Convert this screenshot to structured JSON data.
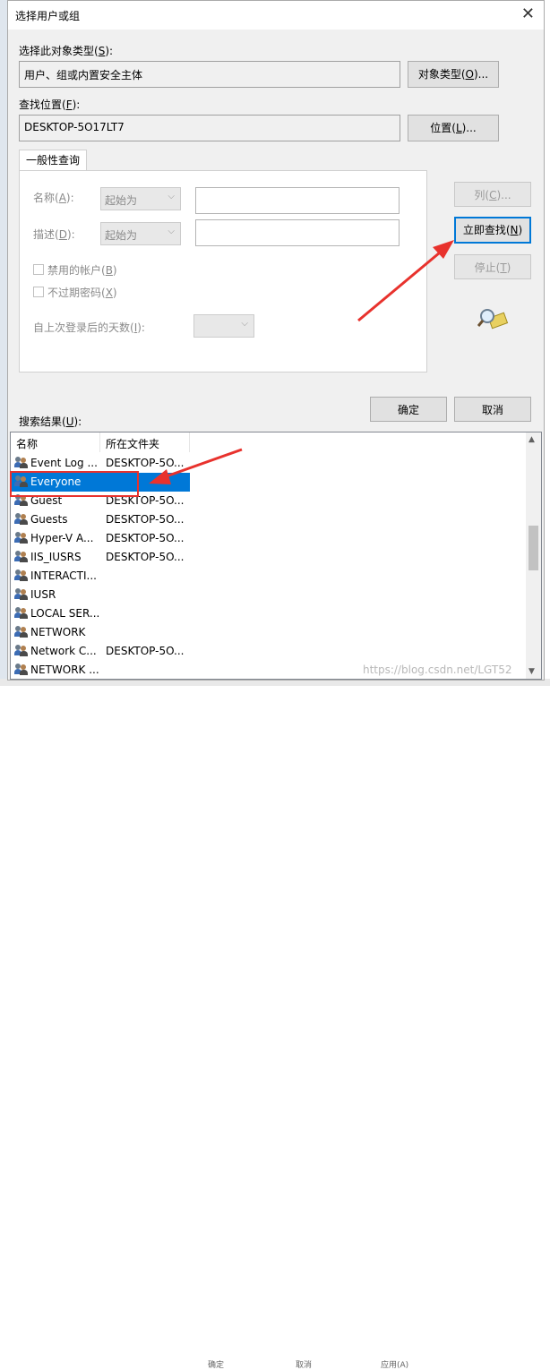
{
  "window": {
    "title": "选择用户或组"
  },
  "object_type": {
    "label_prefix": "选择此对象类型(",
    "label_key": "S",
    "label_suffix": "):",
    "value": "用户、组或内置安全主体",
    "button_prefix": "对象类型(",
    "button_key": "O",
    "button_suffix": ")..."
  },
  "location": {
    "label_prefix": "查找位置(",
    "label_key": "F",
    "label_suffix": "):",
    "value": "DESKTOP-5O17LT7",
    "button_prefix": "位置(",
    "button_key": "L",
    "button_suffix": ")..."
  },
  "general_query": {
    "tab_label": "一般性查询",
    "name_label_prefix": "名称(",
    "name_label_key": "A",
    "name_label_suffix": "):",
    "name_mode": "起始为",
    "desc_label_prefix": "描述(",
    "desc_label_key": "D",
    "desc_label_suffix": "):",
    "desc_mode": "起始为",
    "disabled_accounts_prefix": "禁用的帐户(",
    "disabled_accounts_key": "B",
    "disabled_accounts_suffix": ")",
    "non_expiring_prefix": "不过期密码(",
    "non_expiring_key": "X",
    "non_expiring_suffix": ")",
    "days_since_prefix": "自上次登录后的天数(",
    "days_since_key": "I",
    "days_since_suffix": "):"
  },
  "side_buttons": {
    "columns_prefix": "列(",
    "columns_key": "C",
    "columns_suffix": ")...",
    "find_now_prefix": "立即查找(",
    "find_now_key": "N",
    "find_now_suffix": ")",
    "stop_prefix": "停止(",
    "stop_key": "T",
    "stop_suffix": ")"
  },
  "ok_label": "确定",
  "cancel_label": "取消",
  "results": {
    "label_prefix": "搜索结果(",
    "label_key": "U",
    "label_suffix": "):",
    "columns": [
      "名称",
      "所在文件夹"
    ],
    "rows": [
      {
        "name": "Event Log ...",
        "folder": "DESKTOP-5O..."
      },
      {
        "name": "Everyone",
        "folder": ""
      },
      {
        "name": "Guest",
        "folder": "DESKTOP-5O..."
      },
      {
        "name": "Guests",
        "folder": "DESKTOP-5O..."
      },
      {
        "name": "Hyper-V A...",
        "folder": "DESKTOP-5O..."
      },
      {
        "name": "IIS_IUSRS",
        "folder": "DESKTOP-5O..."
      },
      {
        "name": "INTERACTI...",
        "folder": ""
      },
      {
        "name": "IUSR",
        "folder": ""
      },
      {
        "name": "LOCAL SER...",
        "folder": ""
      },
      {
        "name": "NETWORK",
        "folder": ""
      },
      {
        "name": "Network C...",
        "folder": "DESKTOP-5O..."
      },
      {
        "name": "NETWORK ...",
        "folder": ""
      }
    ],
    "selected_index": 1
  },
  "underlying_buttons": [
    "确定",
    "取消",
    "应用(A)"
  ],
  "watermark": "https://blog.csdn.net/LGT52",
  "colors": {
    "accent": "#0078d7",
    "annotation": "#e8322d"
  }
}
